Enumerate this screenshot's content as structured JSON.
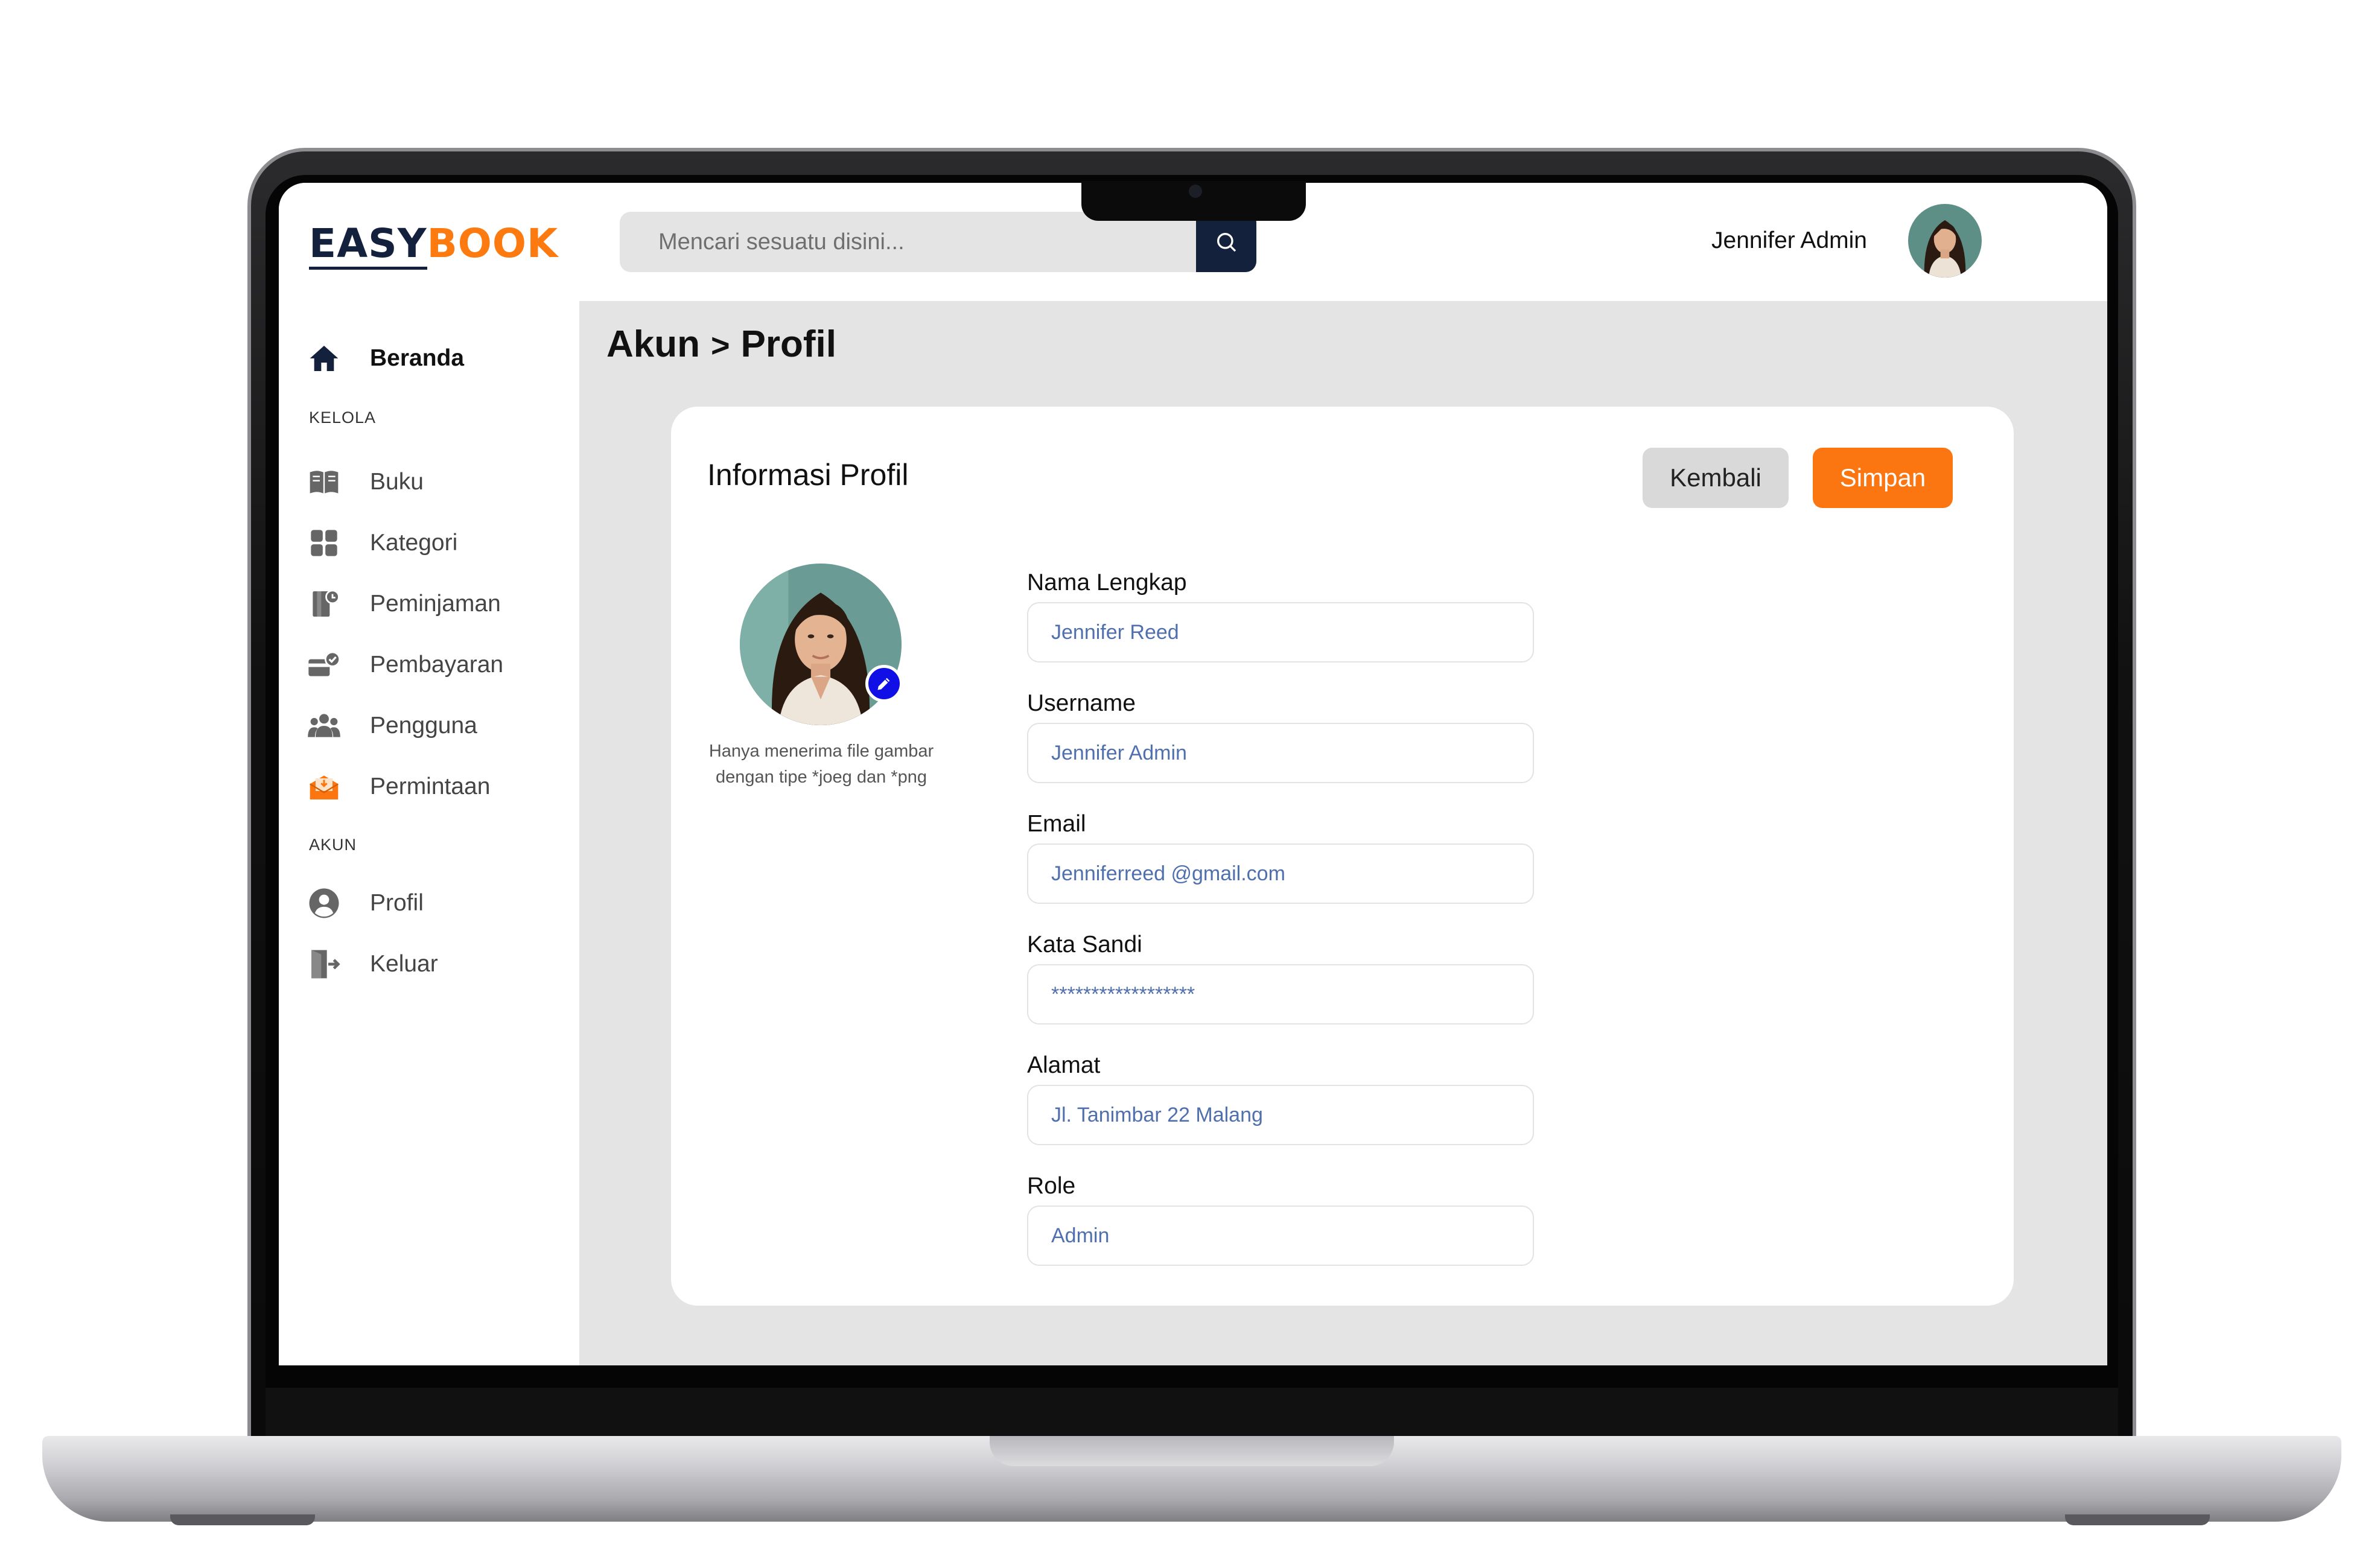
{
  "app": {
    "logo_part1": "EASY",
    "logo_part2": "BOOK",
    "brand_color": "#fc7a0f",
    "navy_color": "#14213d"
  },
  "search": {
    "placeholder": "Mencari sesuatu disini...",
    "icon": "search-icon"
  },
  "user": {
    "name": "Jennifer Admin"
  },
  "sidebar": {
    "home": {
      "label": "Beranda",
      "icon": "home-icon"
    },
    "section_manage": "KELOLA",
    "manage_items": [
      {
        "label": "Buku",
        "icon": "book-icon"
      },
      {
        "label": "Kategori",
        "icon": "category-icon"
      },
      {
        "label": "Peminjaman",
        "icon": "borrow-icon"
      },
      {
        "label": "Pembayaran",
        "icon": "payment-icon"
      },
      {
        "label": "Pengguna",
        "icon": "users-icon"
      },
      {
        "label": "Permintaan",
        "icon": "request-icon"
      }
    ],
    "section_account": "AKUN",
    "account_items": [
      {
        "label": "Profil",
        "icon": "profile-icon"
      },
      {
        "label": "Keluar",
        "icon": "logout-icon"
      }
    ]
  },
  "breadcrumb": {
    "parent": "Akun",
    "separator": ">",
    "current": "Profil"
  },
  "card": {
    "title": "Informasi Profil",
    "back_label": "Kembali",
    "save_label": "Simpan",
    "photo_note": "Hanya menerima file gambar dengan tipe *joeg dan *png"
  },
  "form": {
    "full_name": {
      "label": "Nama Lengkap",
      "value": "Jennifer Reed"
    },
    "username": {
      "label": "Username",
      "value": "Jennifer Admin"
    },
    "email": {
      "label": "Email",
      "value": "Jenniferreed @gmail.com"
    },
    "password": {
      "label": "Kata Sandi",
      "value": "******************"
    },
    "address": {
      "label": "Alamat",
      "value": "Jl. Tanimbar 22 Malang"
    },
    "role": {
      "label": "Role",
      "value": "Admin"
    }
  }
}
